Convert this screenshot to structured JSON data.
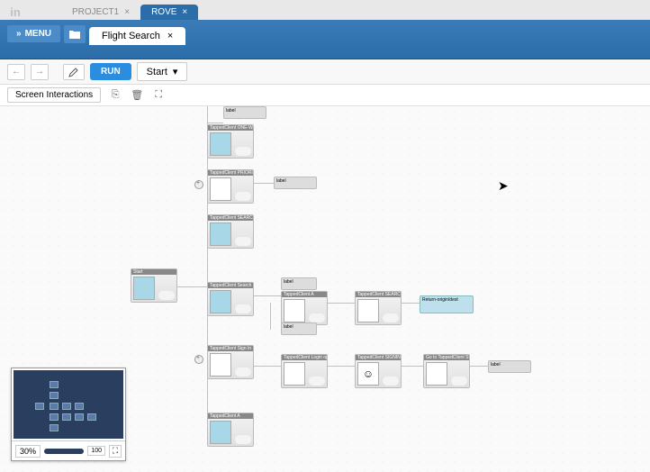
{
  "topbar": {
    "logo": "in",
    "tabs": [
      {
        "label": "PROJECT1",
        "active": false,
        "close": "×"
      },
      {
        "label": "ROVE",
        "active": true,
        "close": "×"
      }
    ]
  },
  "bluebar": {
    "menu_label": "MENU",
    "menu_arrow": "»",
    "sub_tab": "Flight Search",
    "sub_tab_close": "×"
  },
  "toolbar": {
    "back": "←",
    "forward": "→",
    "run_label": "RUN",
    "start_label": "Start",
    "start_caret": "▾"
  },
  "secondbar": {
    "label": "Screen Interactions"
  },
  "minimap": {
    "zoom_value": "30%",
    "zoom_100": "100"
  },
  "nodes": {
    "root": "Start",
    "n1": "TappedClient ONE-WAY",
    "n2": "TappedClient PRIORITY",
    "n3": "TappedClient SEARCH",
    "n4": "TappedClient Search",
    "n5": "TappedClient A",
    "n6": "TappedClient SEARCH",
    "n7": "TappedClient Sign In",
    "n8": "TappedClient Login option",
    "n9": "TappedClient SIGNIN",
    "n10": "Go to TappedClient SEARCH delay",
    "n11": "TappedClient A"
  },
  "labels": {
    "l1": "label",
    "l2": "label",
    "l3": "Return-origin/dest",
    "l4": "label",
    "l5": "label"
  }
}
